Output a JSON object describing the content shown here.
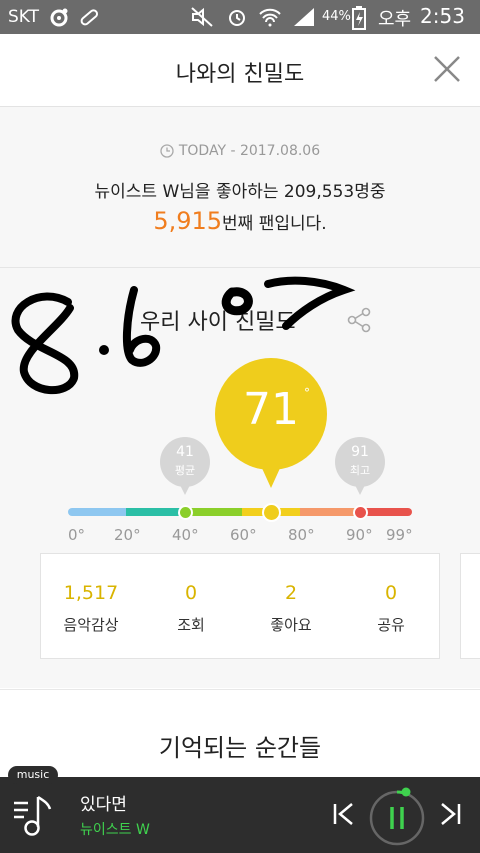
{
  "status_bar": {
    "carrier": "SKT",
    "battery_percent": "44%",
    "ampm": "오후",
    "time": "2:53"
  },
  "header": {
    "title": "나와의 친밀도",
    "close_icon": "close-icon"
  },
  "today": {
    "label": "TODAY - 2017.08.06",
    "fan_line": "뉴이스트 W님을 좋아하는 209,553명중",
    "fan_rank": "5,915",
    "fan_rank_suffix": "번째 팬입니다."
  },
  "intimacy": {
    "title": "우리 사이 친밀도",
    "handwritten_annotation": "8.6 07",
    "my_score": "71",
    "degree_symbol": "°",
    "average": {
      "value": "41",
      "label": "평균"
    },
    "highest": {
      "value": "91",
      "label": "최고"
    },
    "scale_ticks": [
      "0°",
      "20°",
      "40°",
      "60°",
      "80°",
      "90°",
      "99°"
    ],
    "scale_colors": [
      "#8ec7f0",
      "#2bbfa6",
      "#8bcf2a",
      "#f2cf1d",
      "#f5996a",
      "#e8534c"
    ]
  },
  "stats": [
    {
      "value": "1,517",
      "label": "음악감상"
    },
    {
      "value": "0",
      "label": "조회"
    },
    {
      "value": "2",
      "label": "좋아요"
    },
    {
      "value": "0",
      "label": "공유"
    }
  ],
  "moments": {
    "title": "기억되는 순간들"
  },
  "player": {
    "tab_label": "music",
    "song_title": "있다면",
    "artist": "뉴이스트 W"
  },
  "colors": {
    "accent_orange": "#f07d1e",
    "score_yellow": "#efcd1c",
    "stat_value": "#d9b400",
    "artist_green": "#3fd24e",
    "player_bg": "#2d2d2d"
  }
}
